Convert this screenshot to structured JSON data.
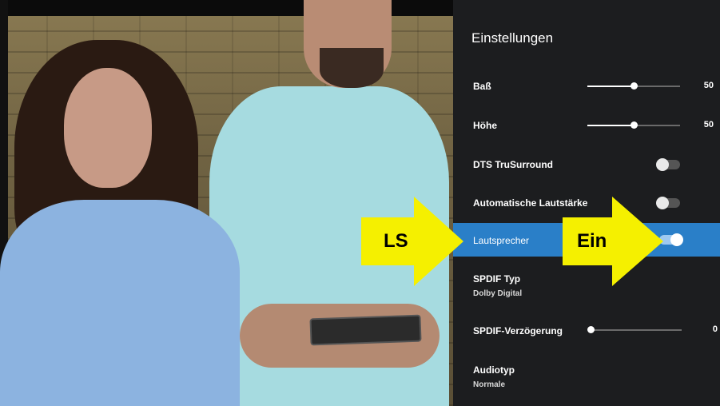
{
  "panel": {
    "title": "Einstellungen",
    "items": [
      {
        "label": "Baß",
        "value": "50",
        "level_percent": 50
      },
      {
        "label": "Höhe",
        "value": "50",
        "level_percent": 50
      },
      {
        "label": "DTS TruSurround",
        "state": "off"
      },
      {
        "label": "Automatische Lautstärke",
        "state": "off"
      },
      {
        "label": "Lautsprecher",
        "state": "on"
      },
      {
        "label": "SPDIF Typ",
        "sublabel": "Dolby Digital"
      },
      {
        "label": "SPDIF-Verzögerung",
        "value": "0",
        "level_percent": 0
      },
      {
        "label": "Audiotyp",
        "sublabel": "Normale"
      }
    ]
  },
  "annotations": {
    "left_arrow_label": "LS",
    "right_arrow_label": "Ein",
    "arrow_color": "#f5f000"
  },
  "colors": {
    "panel_bg": "#1c1d1f",
    "selected_row": "#2a7fc8",
    "toggle_on": "#9ec9f0"
  }
}
